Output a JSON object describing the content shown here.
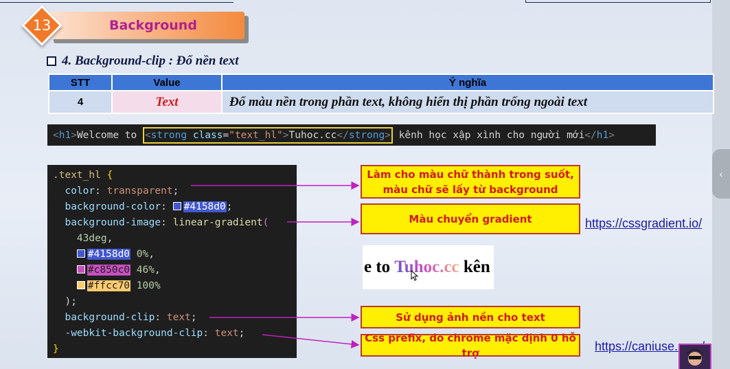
{
  "slide": {
    "number": "13",
    "title": "Background",
    "section": "4. Background-clip : Đổ nền text"
  },
  "table": {
    "headers": [
      "STT",
      "Value",
      "Ý nghĩa"
    ],
    "row": {
      "stt": "4",
      "value": "Text",
      "meaning": "Đổ màu nền trong phần text, không hiển thị phần trống ngoài text"
    }
  },
  "html_code": {
    "open_tag": "h1",
    "text1": "Welcome to ",
    "strong_tag": "strong",
    "attr_name": "class",
    "attr_value": "\"text_hl\"",
    "strong_text": "Tuhoc.cc",
    "text2": " kênh học xập xình cho người mới",
    "close_tag": "h1"
  },
  "css_code": {
    "selector": ".text_hl",
    "open_brace": "{",
    "close_brace": "}",
    "color_prop": "color",
    "color_val": "transparent",
    "bgcolor_prop": "background-color",
    "bgcolor_val": "#4158d0",
    "bgimage_prop": "background-image",
    "bgimage_fn": "linear-gradient",
    "angle": "43deg",
    "stops": [
      {
        "color": "#4158d0",
        "pos": "0%",
        "swatch": "#4158d0"
      },
      {
        "color": "#c850c0",
        "pos": "46%",
        "swatch": "#c850c0"
      },
      {
        "color": "#ffcc70",
        "pos": "100%",
        "swatch": "#ffcc70"
      }
    ],
    "close_paren": ");",
    "clip_prop": "background-clip",
    "clip_val": "text",
    "webkit_prop": "-webkit-background-clip",
    "webkit_val": "text"
  },
  "callouts": {
    "transparent": "Làm cho màu chữ thành trong suốt, màu chữ sẽ lấy từ background",
    "gradient": "Màu chuyển gradient",
    "clip": "Sử dụng ảnh nền cho text",
    "prefix": "Css prefix, do chrome mặc định 0 hỗ trợ"
  },
  "links": {
    "cssgradient": "https://cssgradient.io/",
    "caniuse": "https://caniuse.com/"
  },
  "preview": {
    "before": "e to ",
    "highlight": "Tuhoc.cc",
    "after": " kên"
  },
  "colors": {
    "accent_orange": "#f07a2a",
    "title_text": "#b0208f",
    "table_header": "#3e76d6",
    "callout_bg": "#ffef00",
    "callout_text": "#d11a1a",
    "arrow": "#c020c0"
  },
  "icons": [
    "checkbox-icon",
    "mouse-cursor-icon",
    "chevron-left-icon"
  ]
}
